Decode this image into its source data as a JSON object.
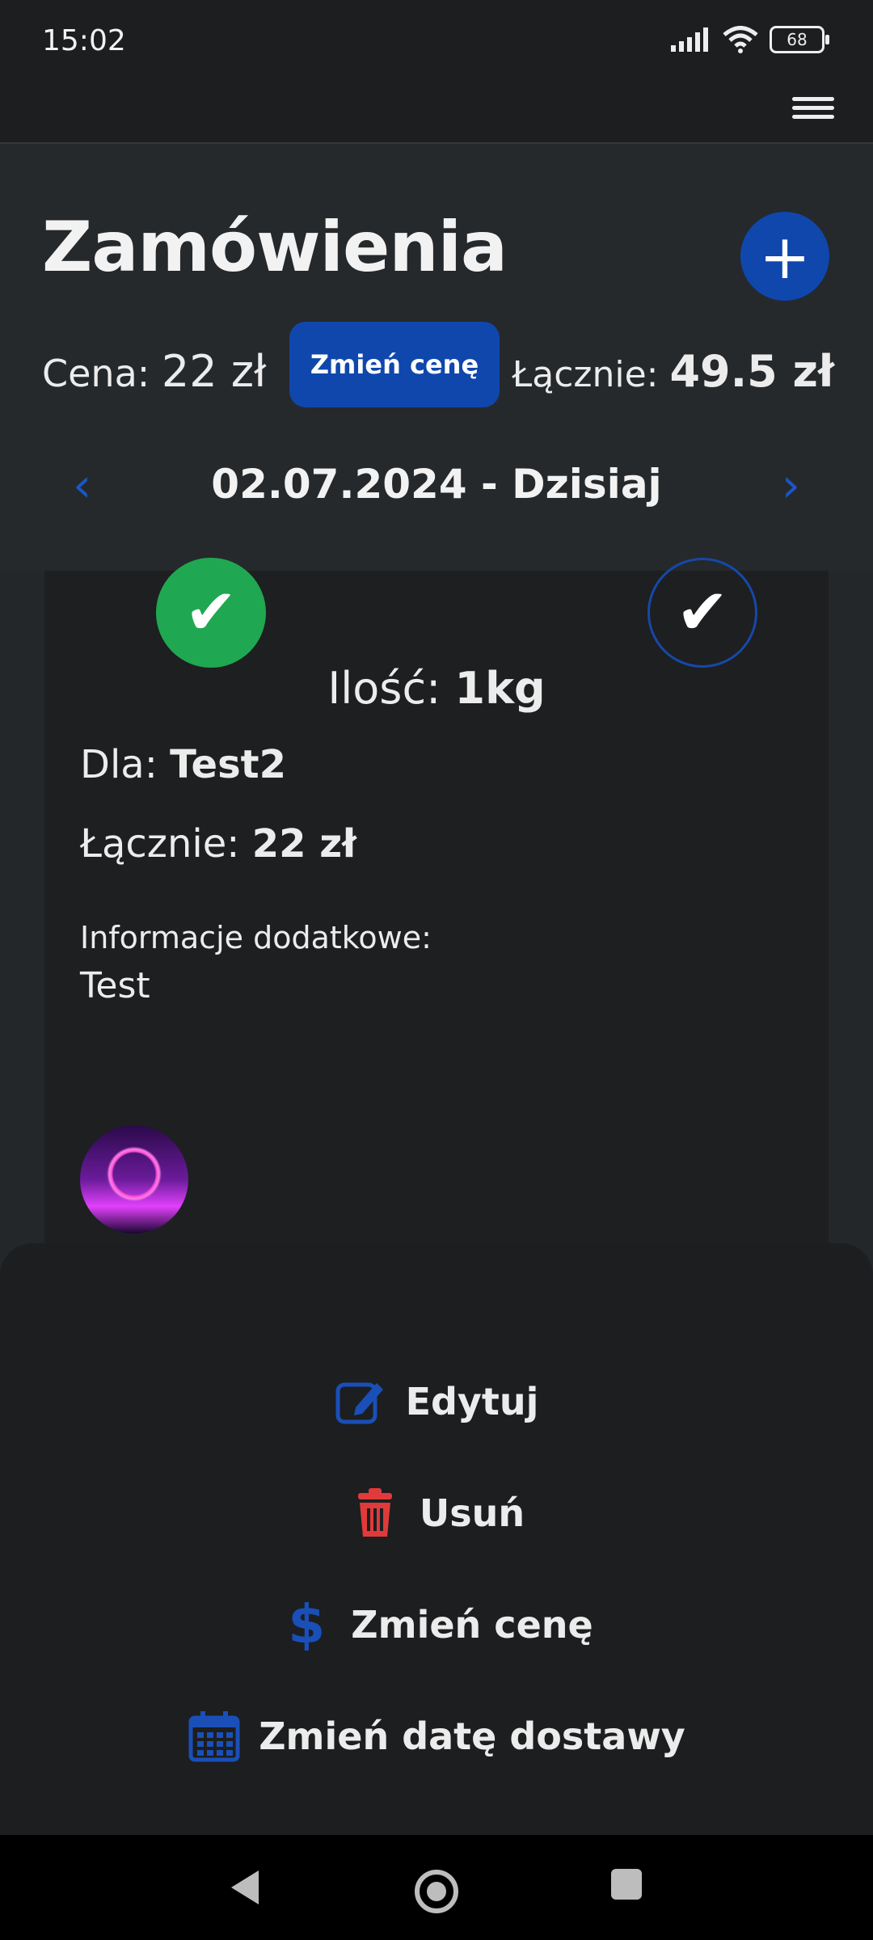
{
  "status": {
    "time": "15:02",
    "battery": "68"
  },
  "header": {
    "title": "Zamówienia",
    "add_label": "+",
    "price_label": "Cena:",
    "price_value": "22 zł",
    "change_price_button": "Zmień cenę",
    "total_label": "Łącznie:",
    "total_value": "49.5 zł",
    "date": "02.07.2024 - Dzisiaj"
  },
  "order": {
    "quantity_label": "Ilość:",
    "quantity_value": "1kg",
    "for_label": "Dla:",
    "for_value": "Test2",
    "total_label": "Łącznie:",
    "total_value": "22 zł",
    "info_label": "Informacje dodatkowe:",
    "info_value": "Test"
  },
  "sheet": {
    "edit": "Edytuj",
    "delete": "Usuń",
    "change_price": "Zmień cenę",
    "change_date": "Zmień datę dostawy"
  },
  "colors": {
    "accent": "#0f47ad",
    "success": "#1fa851",
    "danger": "#e03a3a",
    "background": "#24272a",
    "surface": "#1d1f21"
  }
}
